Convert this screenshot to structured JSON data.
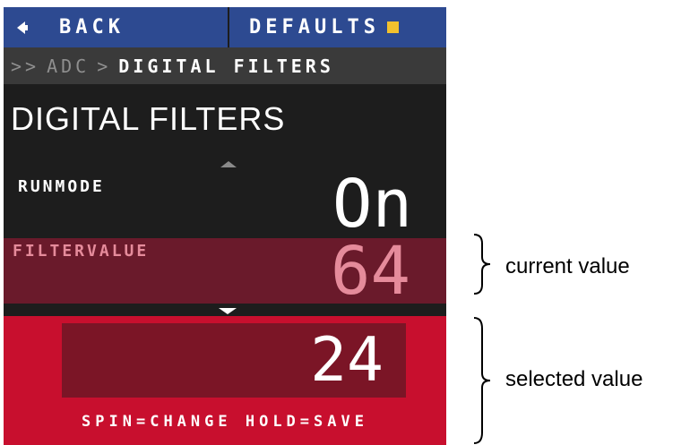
{
  "topbar": {
    "back_label": "BACK",
    "defaults_label": "DEFAULTS"
  },
  "breadcrumb": {
    "prefix": ">>",
    "level1": "ADC",
    "separator": ">",
    "current": "DIGITAL FILTERS"
  },
  "page": {
    "title": "DIGITAL FILTERS"
  },
  "rows": {
    "runmode": {
      "label": "RUNMODE",
      "value": "On"
    },
    "filtervalue": {
      "label": "FILTERVALUE",
      "value": "64"
    }
  },
  "selection": {
    "value": "24",
    "hint": "SPIN=CHANGE HOLD=SAVE"
  },
  "annotations": {
    "current": "current value",
    "selected": "selected value"
  },
  "colors": {
    "topbar": "#2d4a91",
    "breadcrumb_bg": "#3a3a3a",
    "screen_bg": "#1d1d1d",
    "highlight_row": "#6a1a2b",
    "highlight_text": "#e58b9b",
    "select_bg": "#c80f2e",
    "select_box": "#7b1526",
    "defaults_indicator": "#f2c12e"
  }
}
